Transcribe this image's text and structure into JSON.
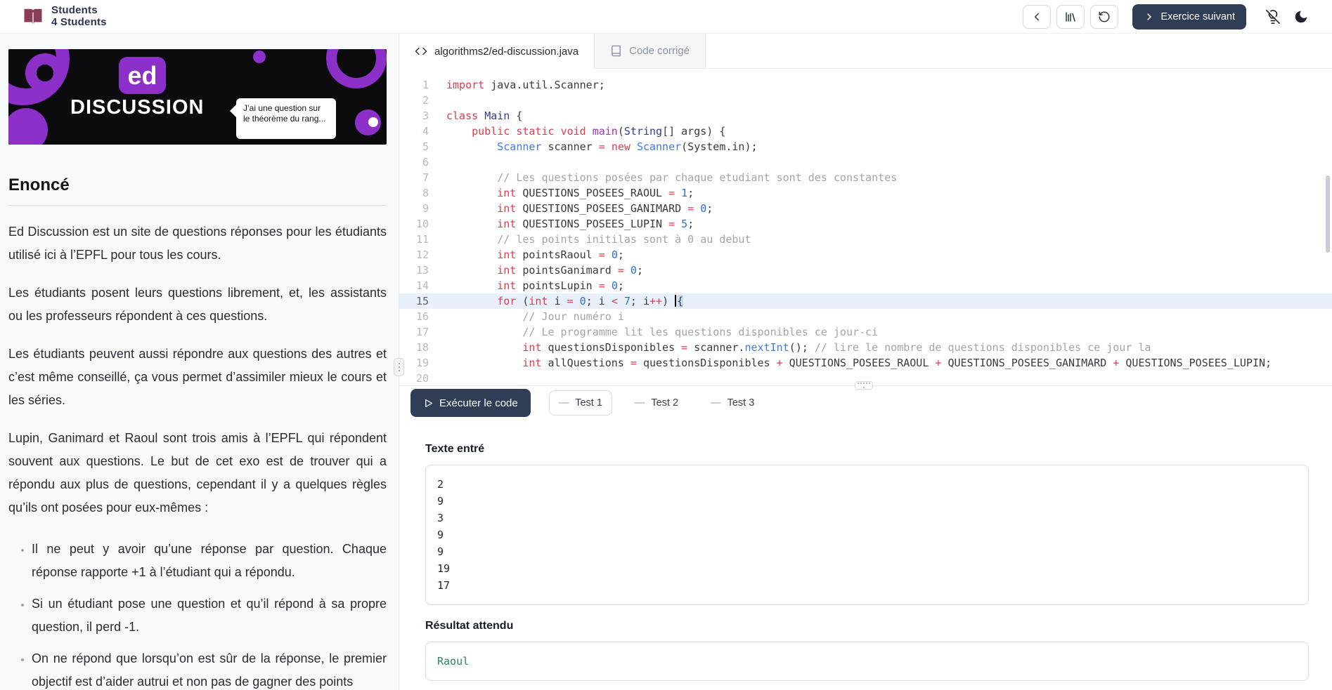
{
  "header": {
    "brand_line1": "Students",
    "brand_line2": "4 Students",
    "next_button": "Exercice suivant"
  },
  "sidebar": {
    "banner": {
      "badge": "ed",
      "title": "DISCUSSION",
      "bubble": "J’ai une question sur le théorème du rang..."
    },
    "heading": "Enoncé",
    "paragraphs": [
      "Ed Discussion est un site de questions réponses pour les étudiants utilisé ici à l’EPFL pour tous les cours.",
      "Les étudiants posent leurs questions librement, et, les assistants ou les professeurs répondent à ces questions.",
      "Les étudiants peuvent aussi répondre aux questions des autres et c’est même conseillé, ça vous permet d’assimiler mieux le cours et les séries.",
      "Lupin, Ganimard et Raoul sont trois amis à l’EPFL qui répondent souvent aux questions. Le but de cet exo est de trouver qui a répondu aux plus de questions, cependant il y a quelques règles qu’ils ont posées pour eux-mêmes :"
    ],
    "bullets": [
      "Il ne peut y avoir qu’une réponse par question. Chaque réponse rapporte +1 à l’étudiant qui a répondu.",
      "Si un étudiant pose une question et qu’il répond à sa propre question, il perd -1.",
      "On ne répond que lorsqu’on est sûr de la réponse, le premier objectif est d’aider autrui et non pas de gagner des points"
    ]
  },
  "tabs": [
    {
      "label": "algorithms2/ed-discussion.java",
      "active": true
    },
    {
      "label": "Code corrigé",
      "active": false
    }
  ],
  "editor": {
    "lines": [
      {
        "n": 1,
        "tokens": [
          [
            "kw",
            "import"
          ],
          [
            "pl",
            " java.util.Scanner;"
          ]
        ]
      },
      {
        "n": 2,
        "tokens": []
      },
      {
        "n": 3,
        "tokens": [
          [
            "kw",
            "class"
          ],
          [
            "pl",
            " "
          ],
          [
            "cls",
            "Main"
          ],
          [
            "pl",
            " {"
          ]
        ]
      },
      {
        "n": 4,
        "tokens": [
          [
            "pl",
            "    "
          ],
          [
            "kw",
            "public"
          ],
          [
            "pl",
            " "
          ],
          [
            "kw",
            "static"
          ],
          [
            "pl",
            " "
          ],
          [
            "kw",
            "void"
          ],
          [
            "pl",
            " "
          ],
          [
            "fn",
            "main"
          ],
          [
            "pl",
            "("
          ],
          [
            "cls",
            "String"
          ],
          [
            "pl",
            "[] args) {"
          ]
        ]
      },
      {
        "n": 5,
        "tokens": [
          [
            "pl",
            "        "
          ],
          [
            "type",
            "Scanner"
          ],
          [
            "pl",
            " scanner "
          ],
          [
            "op",
            "="
          ],
          [
            "pl",
            " "
          ],
          [
            "kw",
            "new"
          ],
          [
            "pl",
            " "
          ],
          [
            "type",
            "Scanner"
          ],
          [
            "pl",
            "(System.in);"
          ]
        ]
      },
      {
        "n": 6,
        "tokens": []
      },
      {
        "n": 7,
        "tokens": [
          [
            "pl",
            "        "
          ],
          [
            "cm",
            "// Les questions posées par chaque etudiant sont des constantes"
          ]
        ]
      },
      {
        "n": 8,
        "tokens": [
          [
            "pl",
            "        "
          ],
          [
            "kw",
            "int"
          ],
          [
            "pl",
            " QUESTIONS_POSEES_RAOUL "
          ],
          [
            "op",
            "="
          ],
          [
            "pl",
            " "
          ],
          [
            "num",
            "1"
          ],
          [
            "pl",
            ";"
          ]
        ]
      },
      {
        "n": 9,
        "tokens": [
          [
            "pl",
            "        "
          ],
          [
            "kw",
            "int"
          ],
          [
            "pl",
            " QUESTIONS_POSEES_GANIMARD "
          ],
          [
            "op",
            "="
          ],
          [
            "pl",
            " "
          ],
          [
            "num",
            "0"
          ],
          [
            "pl",
            ";"
          ]
        ]
      },
      {
        "n": 10,
        "tokens": [
          [
            "pl",
            "        "
          ],
          [
            "kw",
            "int"
          ],
          [
            "pl",
            " QUESTIONS_POSEES_LUPIN "
          ],
          [
            "op",
            "="
          ],
          [
            "pl",
            " "
          ],
          [
            "num",
            "5"
          ],
          [
            "pl",
            ";"
          ]
        ]
      },
      {
        "n": 11,
        "tokens": [
          [
            "pl",
            "        "
          ],
          [
            "cm",
            "// les points initilas sont à 0 au debut"
          ]
        ]
      },
      {
        "n": 12,
        "tokens": [
          [
            "pl",
            "        "
          ],
          [
            "kw",
            "int"
          ],
          [
            "pl",
            " pointsRaoul "
          ],
          [
            "op",
            "="
          ],
          [
            "pl",
            " "
          ],
          [
            "num",
            "0"
          ],
          [
            "pl",
            ";"
          ]
        ]
      },
      {
        "n": 13,
        "tokens": [
          [
            "pl",
            "        "
          ],
          [
            "kw",
            "int"
          ],
          [
            "pl",
            " pointsGanimard "
          ],
          [
            "op",
            "="
          ],
          [
            "pl",
            " "
          ],
          [
            "num",
            "0"
          ],
          [
            "pl",
            ";"
          ]
        ]
      },
      {
        "n": 14,
        "tokens": [
          [
            "pl",
            "        "
          ],
          [
            "kw",
            "int"
          ],
          [
            "pl",
            " pointsLupin "
          ],
          [
            "op",
            "="
          ],
          [
            "pl",
            " "
          ],
          [
            "num",
            "0"
          ],
          [
            "pl",
            ";"
          ]
        ]
      },
      {
        "n": 15,
        "active": true,
        "tokens": [
          [
            "pl",
            "        "
          ],
          [
            "kw",
            "for"
          ],
          [
            "pl",
            " ("
          ],
          [
            "kw",
            "int"
          ],
          [
            "pl",
            " i "
          ],
          [
            "op",
            "="
          ],
          [
            "pl",
            " "
          ],
          [
            "num",
            "0"
          ],
          [
            "pl",
            "; i "
          ],
          [
            "op",
            "<"
          ],
          [
            "pl",
            " "
          ],
          [
            "num",
            "7"
          ],
          [
            "pl",
            "; i"
          ],
          [
            "op",
            "++"
          ],
          [
            "pl",
            ") "
          ],
          [
            "cursor",
            ""
          ],
          [
            "brkt",
            "{"
          ]
        ]
      },
      {
        "n": 16,
        "tokens": [
          [
            "pl",
            "            "
          ],
          [
            "cm",
            "// Jour numéro i"
          ]
        ]
      },
      {
        "n": 17,
        "tokens": [
          [
            "pl",
            "            "
          ],
          [
            "cm",
            "// Le programme lit les questions disponibles ce jour-ci"
          ]
        ]
      },
      {
        "n": 18,
        "tokens": [
          [
            "pl",
            "            "
          ],
          [
            "kw",
            "int"
          ],
          [
            "pl",
            " questionsDisponibles "
          ],
          [
            "op",
            "="
          ],
          [
            "pl",
            " scanner."
          ],
          [
            "type",
            "nextInt"
          ],
          [
            "pl",
            "(); "
          ],
          [
            "cm",
            "// lire le nombre de questions disponibles ce jour la"
          ]
        ]
      },
      {
        "n": 19,
        "tokens": [
          [
            "pl",
            "            "
          ],
          [
            "kw",
            "int"
          ],
          [
            "pl",
            " allQuestions "
          ],
          [
            "op",
            "="
          ],
          [
            "pl",
            " questionsDisponibles "
          ],
          [
            "op",
            "+"
          ],
          [
            "pl",
            " QUESTIONS_POSEES_RAOUL "
          ],
          [
            "op",
            "+"
          ],
          [
            "pl",
            " QUESTIONS_POSEES_GANIMARD "
          ],
          [
            "op",
            "+"
          ],
          [
            "pl",
            " QUESTIONS_POSEES_LUPIN;"
          ]
        ]
      },
      {
        "n": 20,
        "tokens": []
      }
    ]
  },
  "runbar": {
    "execute_label": "Exécuter le code",
    "tests": [
      "Test 1",
      "Test 2",
      "Test 3"
    ],
    "active_test": 0
  },
  "results": {
    "input_label": "Texte entré",
    "input_lines": [
      "2",
      "9",
      "3",
      "9",
      "9",
      "19",
      "17"
    ],
    "output_label": "Résultat attendu",
    "output_value": "Raoul"
  },
  "colors": {
    "accent_navy": "#2f3d56",
    "banner_purple": "#8d2fc9",
    "keyword_red": "#e13b4e",
    "comment_gray": "#a0a4ab",
    "number_blue": "#2f6bd8",
    "type_blue": "#4078f2",
    "function_purple": "#a435a8",
    "output_green": "#2f855a",
    "sidebar_bg": "#f8f9fb"
  }
}
